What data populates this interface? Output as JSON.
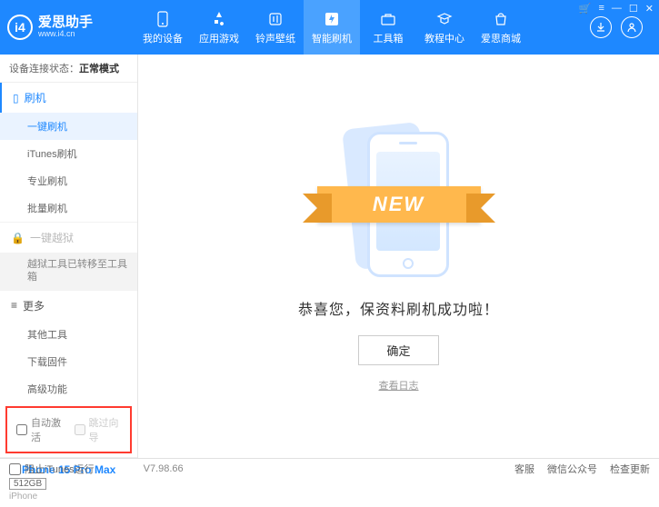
{
  "header": {
    "logo_title": "爱思助手",
    "logo_url": "www.i4.cn",
    "nav": [
      {
        "label": "我的设备"
      },
      {
        "label": "应用游戏"
      },
      {
        "label": "铃声壁纸"
      },
      {
        "label": "智能刷机"
      },
      {
        "label": "工具箱"
      },
      {
        "label": "教程中心"
      },
      {
        "label": "爱思商城"
      }
    ]
  },
  "sidebar": {
    "status_label": "设备连接状态：",
    "status_value": "正常模式",
    "flash_head": "刷机",
    "flash_items": [
      "一键刷机",
      "iTunes刷机",
      "专业刷机",
      "批量刷机"
    ],
    "jailbreak_head": "一键越狱",
    "jailbreak_note": "越狱工具已转移至工具箱",
    "more_head": "更多",
    "more_items": [
      "其他工具",
      "下载固件",
      "高级功能"
    ],
    "checkbox1": "自动激活",
    "checkbox2": "跳过向导",
    "device_name": "iPhone 15 Pro Max",
    "device_storage": "512GB",
    "device_type": "iPhone"
  },
  "main": {
    "ribbon": "NEW",
    "success_text": "恭喜您，保资料刷机成功啦！",
    "confirm_btn": "确定",
    "view_log": "查看日志"
  },
  "footer": {
    "block_itunes": "阻止iTunes运行",
    "version": "V7.98.66",
    "links": [
      "客服",
      "微信公众号",
      "检查更新"
    ]
  }
}
